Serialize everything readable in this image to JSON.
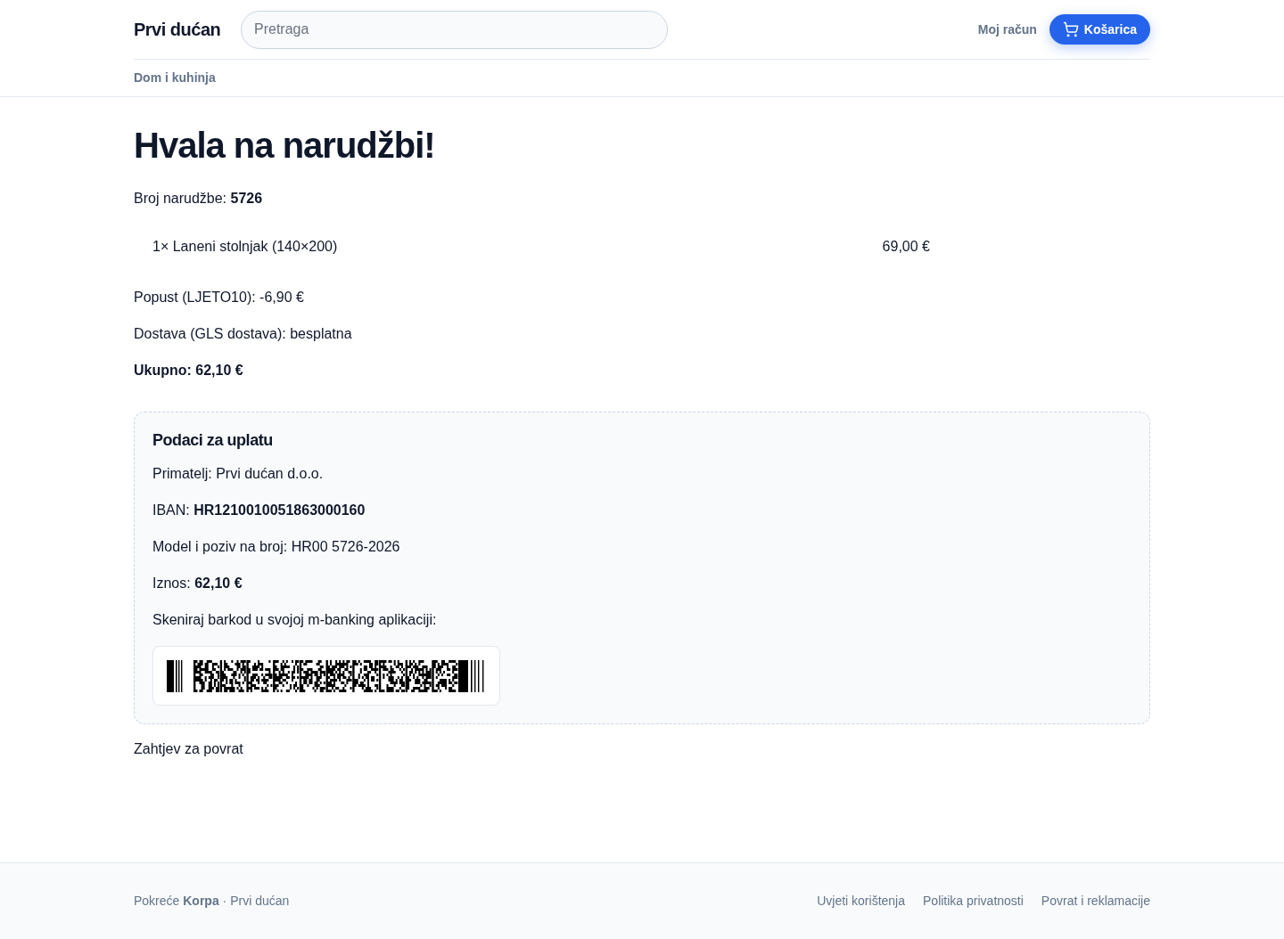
{
  "header": {
    "logo": "Prvi dućan",
    "search": {
      "placeholder": "Pretraga"
    },
    "account_link": "Moj račun",
    "cart_button": "Košarica"
  },
  "breadcrumb": [
    "Dom i kuhinja"
  ],
  "title": "Hvala na narudžbi!",
  "order_number": "Broj narudžbe: **5726**",
  "items": [
    {
      "description": "1× Laneni stolnjak (140×200)",
      "price": "69,00 €"
    }
  ],
  "discount": "Popust (LJETO10): -6,90 €",
  "shipping": "Dostava (GLS dostava): besplatna",
  "total": "Ukupno: 62,10 €",
  "payment": {
    "title": "Podaci za uplatu",
    "lines": [
      "Primatelj: Prvi dućan d.o.o.",
      "IBAN: **HR1210010051863000160**",
      "Model i poziv na broj: HR00 5726-2026",
      "Iznos: **62,10 €**"
    ],
    "scan_hint": "Skeniraj barkod u svojoj m-banking aplikaciji:"
  },
  "return_link": "Zahtjev za povrat",
  "footer": {
    "credit": "Pokreće **Korpa** · Prvi dućan",
    "links": [
      "Uvjeti korištenja",
      "Politika privatnosti",
      "Povrat i reklamacije"
    ]
  }
}
